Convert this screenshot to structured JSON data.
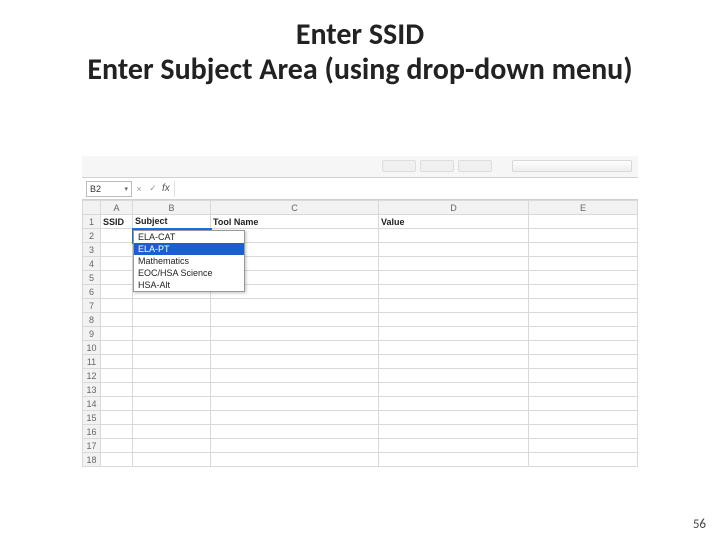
{
  "title": {
    "line1": "Enter SSID",
    "line2": "Enter Subject Area (using drop-down menu)"
  },
  "page_number": "56",
  "spreadsheet": {
    "active_cell": "B2",
    "fx_label": "fx",
    "column_headers": [
      "A",
      "B",
      "C",
      "D",
      "E"
    ],
    "row_numbers": [
      "1",
      "2",
      "3",
      "4",
      "5",
      "6",
      "7",
      "8",
      "9",
      "10",
      "11",
      "12",
      "13",
      "14",
      "15",
      "16",
      "17",
      "18"
    ],
    "header_row": {
      "A": "SSID",
      "B": "Subject",
      "C": "Tool Name",
      "D": "Value",
      "E": ""
    },
    "dropdown": {
      "options": [
        "ELA-CAT",
        "ELA-PT",
        "Mathematics",
        "EOC/HSA Science",
        "HSA-Alt"
      ],
      "highlighted_index": 1
    }
  }
}
